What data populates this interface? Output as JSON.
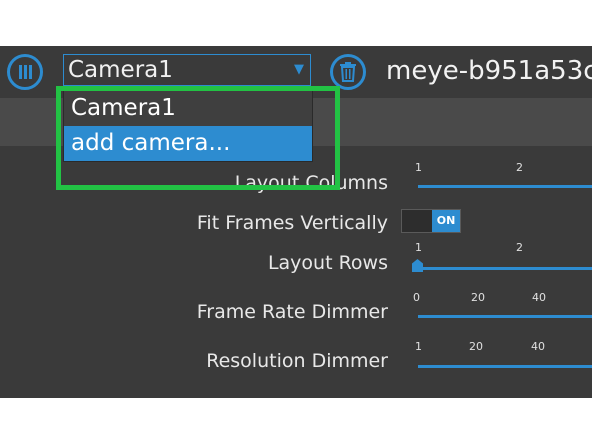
{
  "header": {
    "camera_select_value": "Camera1",
    "camera_title": "meye-b951a53c"
  },
  "dropdown": {
    "options": [
      "Camera1",
      "add camera..."
    ],
    "highlighted_option": "add camera..."
  },
  "settings": {
    "layout_columns": {
      "label": "Layout Columns",
      "ticks": [
        "1",
        "2"
      ]
    },
    "fit_frames_vertically": {
      "label": "Fit Frames Vertically",
      "toggle_label": "ON",
      "value": true
    },
    "layout_rows": {
      "label": "Layout Rows",
      "ticks": [
        "1",
        "2"
      ],
      "value": 1
    },
    "frame_rate_dimmer": {
      "label": "Frame Rate Dimmer",
      "ticks": [
        "0",
        "20",
        "40"
      ]
    },
    "resolution_dimmer": {
      "label": "Resolution Dimmer",
      "ticks": [
        "1",
        "20",
        "40"
      ]
    }
  },
  "icons": {
    "menu": "menu-icon",
    "trash": "trash-icon",
    "caret": "chevron-down-icon"
  },
  "colors": {
    "accent": "#2d8cd0",
    "background_dark": "#3a3a3a",
    "highlight_box": "#22c244"
  }
}
